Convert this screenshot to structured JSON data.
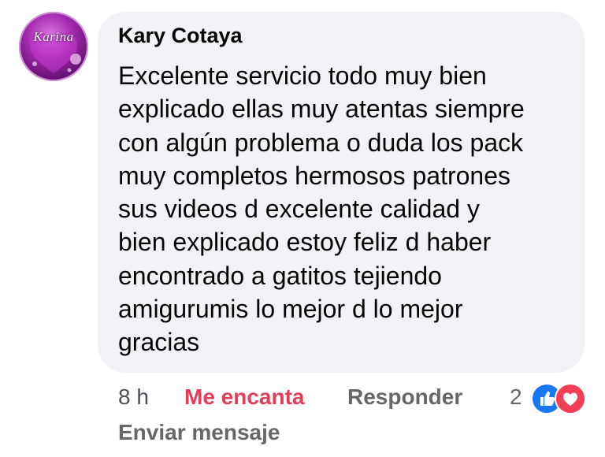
{
  "comment": {
    "avatar_text": "Karina",
    "author": "Kary Cotaya",
    "text_lines": [
      "Excelente servicio todo muy bien",
      "explicado ellas muy atentas siempre",
      "con algún problema o duda los pack",
      "muy completos hermosos patrones",
      "sus videos d excelente calidad y",
      "bien explicado estoy feliz d haber",
      "encontrado a gatitos tejiendo",
      "amigurumis lo mejor d lo mejor",
      "gracias"
    ],
    "time": "8 h",
    "reaction_label": "Me encanta",
    "reply_label": "Responder",
    "reaction_count": "2",
    "reaction_icons": [
      "like-icon",
      "love-icon"
    ],
    "send_message_label": "Enviar mensaje"
  },
  "colors": {
    "bubble_bg": "#f0f2f5",
    "reaction_active": "#e23e57",
    "secondary_text": "#65676b",
    "like_blue": "#1877f2",
    "love_red": "#f33e58"
  }
}
